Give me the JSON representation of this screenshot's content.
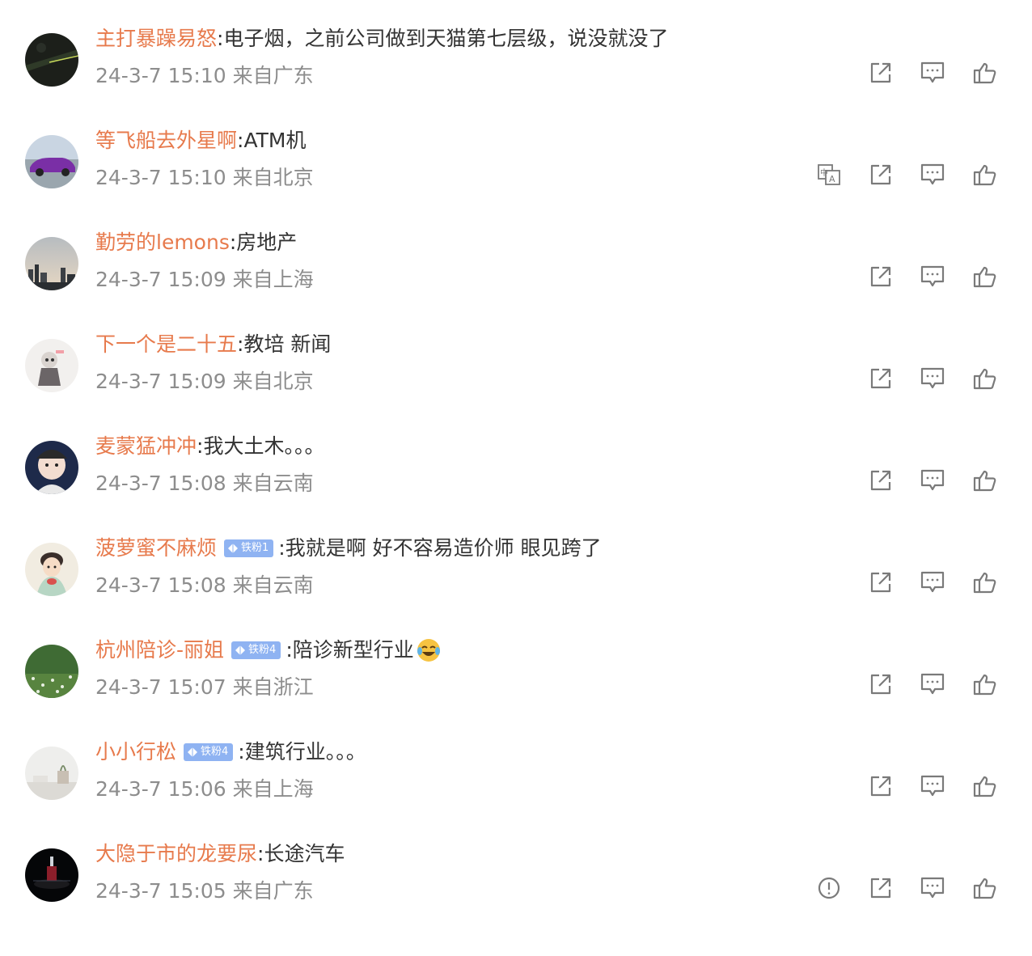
{
  "comments": [
    {
      "name": "主打暴躁易怒",
      "text": "电子烟，之前公司做到天猫第七层级，说没就没了",
      "meta": "24-3-7 15:10 来自广东",
      "badge": null,
      "translate": false,
      "report": false,
      "avatar": "night-car"
    },
    {
      "name": "等飞船去外星啊",
      "text": "ATM机",
      "meta": "24-3-7 15:10 来自北京",
      "badge": null,
      "translate": true,
      "report": false,
      "avatar": "purple-car"
    },
    {
      "name": "勤劳的lemons",
      "text": "房地产",
      "meta": "24-3-7 15:09 来自上海",
      "badge": null,
      "translate": false,
      "report": false,
      "avatar": "city-sunset"
    },
    {
      "name": "下一个是二十五",
      "text": "教培 新闻",
      "meta": "24-3-7 15:09 来自北京",
      "badge": null,
      "translate": false,
      "report": false,
      "avatar": "doll"
    },
    {
      "name": "麦蒙猛冲冲",
      "text": "我大土木。。。",
      "meta": "24-3-7 15:08 来自云南",
      "badge": null,
      "translate": false,
      "report": false,
      "avatar": "baby"
    },
    {
      "name": "菠萝蜜不麻烦",
      "text": "我就是啊 好不容易造价师 眼见跨了",
      "meta": "24-3-7 15:08 来自云南",
      "badge": "铁粉1",
      "translate": false,
      "report": false,
      "avatar": "illustration"
    },
    {
      "name": "杭州陪诊-丽姐",
      "text": "陪诊新型行业",
      "meta": "24-3-7 15:07 来自浙江",
      "badge": "铁粉4",
      "translate": false,
      "report": false,
      "avatar": "flowers",
      "emoji": "laughing-tears"
    },
    {
      "name": "小小行松",
      "text": "建筑行业。。。",
      "meta": "24-3-7 15:06 来自上海",
      "badge": "铁粉4",
      "translate": false,
      "report": false,
      "avatar": "room"
    },
    {
      "name": "大隐于市的龙要尿",
      "text": "长途汽车",
      "meta": "24-3-7 15:05 来自广东",
      "badge": null,
      "translate": false,
      "report": true,
      "avatar": "dark-stage"
    }
  ],
  "separator": ":",
  "icons": {
    "translate": "translate-icon",
    "report": "report-icon",
    "share": "share-icon",
    "comment": "comment-icon",
    "like": "like-icon"
  },
  "colors": {
    "username": "#e77a4c",
    "text": "#333333",
    "meta": "#8d8d8d",
    "icon": "#7a7a7a",
    "badge": "#8fb3f2"
  }
}
